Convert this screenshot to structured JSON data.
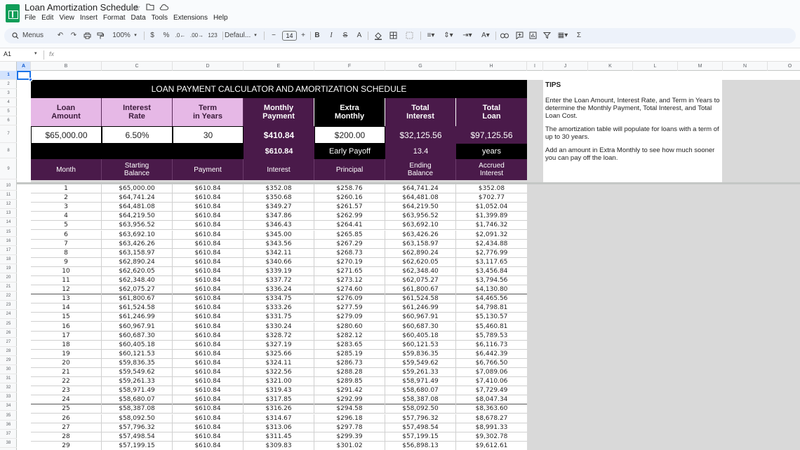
{
  "app": {
    "doc_title": "Loan Amortization Schedule",
    "menus": [
      "File",
      "Edit",
      "View",
      "Insert",
      "Format",
      "Data",
      "Tools",
      "Extensions",
      "Help"
    ]
  },
  "toolbar": {
    "search_menus": "Menus",
    "zoom": "100%",
    "currency": "$",
    "percent": "%",
    "decrease_decimal": ".0←",
    ".increase_decimal": ".00",
    "increase_decimal": ".00→",
    "number_format": "123",
    "font": "Defaul...",
    "font_size": "14",
    "bold": "B",
    "italic": "I",
    "strike": "S",
    "text_color": "A",
    "sum": "Σ"
  },
  "formula_bar": {
    "cell_ref": "A1",
    "fx": "fx"
  },
  "columns": [
    "A",
    "B",
    "C",
    "D",
    "E",
    "F",
    "G",
    "H",
    "I",
    "J",
    "K",
    "L",
    "M",
    "N",
    "O"
  ],
  "rows": [
    "1",
    "2",
    "3",
    "4",
    "5",
    "6",
    "7",
    "8",
    "9",
    "10",
    "11",
    "12",
    "13",
    "14",
    "15",
    "16",
    "17",
    "18",
    "19",
    "20",
    "21",
    "22",
    "23",
    "24",
    "25",
    "26",
    "27",
    "28",
    "29",
    "30",
    "31",
    "32",
    "33",
    "34",
    "35",
    "36",
    "37",
    "38"
  ],
  "calculator": {
    "title": "LOAN PAYMENT CALCULATOR AND AMORTIZATION SCHEDULE",
    "headers": {
      "loan_amount_1": "Loan",
      "loan_amount_2": "Amount",
      "interest_rate_1": "Interest",
      "interest_rate_2": "Rate",
      "term_1": "Term",
      "term_2": "in Years",
      "monthly_payment_1": "Monthly",
      "monthly_payment_2": "Payment",
      "extra_monthly_1": "Extra",
      "extra_monthly_2": "Monthly",
      "total_interest_1": "Total",
      "total_interest_2": "Interest",
      "total_loan_1": "Total",
      "total_loan_2": "Loan"
    },
    "values": {
      "loan_amount": "$65,000.00",
      "interest_rate": "6.50%",
      "term": "30",
      "monthly_payment": "$410.84",
      "extra_monthly": "$200.00",
      "total_interest": "$32,125.56",
      "total_loan": "$97,125.56"
    },
    "payoff": {
      "total_payment": "$610.84",
      "label": "Early Payoff",
      "years": "13.4",
      "unit": "years"
    },
    "table_headers": {
      "month": "Month",
      "starting_balance_1": "Starting",
      "starting_balance_2": "Balance",
      "payment": "Payment",
      "interest": "Interest",
      "principal": "Principal",
      "ending_balance_1": "Ending",
      "ending_balance_2": "Balance",
      "accrued_interest_1": "Accrued",
      "accrued_interest_2": "Interest"
    }
  },
  "tips": {
    "title": "TIPS",
    "p1": "Enter the Loan Amount, Interest Rate, and Term in Years to determine the Monthly Payment, Total Interest, and Total Loan Cost.",
    "p2": "The amortization table will populate for loans with a term of up to 30 years.",
    "p3": "Add an amount in Extra Monthly to see how much sooner you can pay off the loan."
  },
  "schedule": [
    [
      "1",
      "$65,000.00",
      "$610.84",
      "$352.08",
      "$258.76",
      "$64,741.24",
      "$352.08"
    ],
    [
      "2",
      "$64,741.24",
      "$610.84",
      "$350.68",
      "$260.16",
      "$64,481.08",
      "$702.77"
    ],
    [
      "3",
      "$64,481.08",
      "$610.84",
      "$349.27",
      "$261.57",
      "$64,219.50",
      "$1,052.04"
    ],
    [
      "4",
      "$64,219.50",
      "$610.84",
      "$347.86",
      "$262.99",
      "$63,956.52",
      "$1,399.89"
    ],
    [
      "5",
      "$63,956.52",
      "$610.84",
      "$346.43",
      "$264.41",
      "$63,692.10",
      "$1,746.32"
    ],
    [
      "6",
      "$63,692.10",
      "$610.84",
      "$345.00",
      "$265.85",
      "$63,426.26",
      "$2,091.32"
    ],
    [
      "7",
      "$63,426.26",
      "$610.84",
      "$343.56",
      "$267.29",
      "$63,158.97",
      "$2,434.88"
    ],
    [
      "8",
      "$63,158.97",
      "$610.84",
      "$342.11",
      "$268.73",
      "$62,890.24",
      "$2,776.99"
    ],
    [
      "9",
      "$62,890.24",
      "$610.84",
      "$340.66",
      "$270.19",
      "$62,620.05",
      "$3,117.65"
    ],
    [
      "10",
      "$62,620.05",
      "$610.84",
      "$339.19",
      "$271.65",
      "$62,348.40",
      "$3,456.84"
    ],
    [
      "11",
      "$62,348.40",
      "$610.84",
      "$337.72",
      "$273.12",
      "$62,075.27",
      "$3,794.56"
    ],
    [
      "12",
      "$62,075.27",
      "$610.84",
      "$336.24",
      "$274.60",
      "$61,800.67",
      "$4,130.80"
    ],
    [
      "13",
      "$61,800.67",
      "$610.84",
      "$334.75",
      "$276.09",
      "$61,524.58",
      "$4,465.56"
    ],
    [
      "14",
      "$61,524.58",
      "$610.84",
      "$333.26",
      "$277.59",
      "$61,246.99",
      "$4,798.81"
    ],
    [
      "15",
      "$61,246.99",
      "$610.84",
      "$331.75",
      "$279.09",
      "$60,967.91",
      "$5,130.57"
    ],
    [
      "16",
      "$60,967.91",
      "$610.84",
      "$330.24",
      "$280.60",
      "$60,687.30",
      "$5,460.81"
    ],
    [
      "17",
      "$60,687.30",
      "$610.84",
      "$328.72",
      "$282.12",
      "$60,405.18",
      "$5,789.53"
    ],
    [
      "18",
      "$60,405.18",
      "$610.84",
      "$327.19",
      "$283.65",
      "$60,121.53",
      "$6,116.73"
    ],
    [
      "19",
      "$60,121.53",
      "$610.84",
      "$325.66",
      "$285.19",
      "$59,836.35",
      "$6,442.39"
    ],
    [
      "20",
      "$59,836.35",
      "$610.84",
      "$324.11",
      "$286.73",
      "$59,549.62",
      "$6,766.50"
    ],
    [
      "21",
      "$59,549.62",
      "$610.84",
      "$322.56",
      "$288.28",
      "$59,261.33",
      "$7,089.06"
    ],
    [
      "22",
      "$59,261.33",
      "$610.84",
      "$321.00",
      "$289.85",
      "$58,971.49",
      "$7,410.06"
    ],
    [
      "23",
      "$58,971.49",
      "$610.84",
      "$319.43",
      "$291.42",
      "$58,680.07",
      "$7,729.49"
    ],
    [
      "24",
      "$58,680.07",
      "$610.84",
      "$317.85",
      "$292.99",
      "$58,387.08",
      "$8,047.34"
    ],
    [
      "25",
      "$58,387.08",
      "$610.84",
      "$316.26",
      "$294.58",
      "$58,092.50",
      "$8,363.60"
    ],
    [
      "26",
      "$58,092.50",
      "$610.84",
      "$314.67",
      "$296.18",
      "$57,796.32",
      "$8,678.27"
    ],
    [
      "27",
      "$57,796.32",
      "$610.84",
      "$313.06",
      "$297.78",
      "$57,498.54",
      "$8,991.33"
    ],
    [
      "28",
      "$57,498.54",
      "$610.84",
      "$311.45",
      "$299.39",
      "$57,199.15",
      "$9,302.78"
    ],
    [
      "29",
      "$57,199.15",
      "$610.84",
      "$309.83",
      "$301.02",
      "$56,898.13",
      "$9,612.61"
    ]
  ],
  "colors": {
    "header_light": "#e6b8e6",
    "header_dark": "#4a1a4a",
    "banner": "#000000",
    "selection": "#1a73e8"
  }
}
